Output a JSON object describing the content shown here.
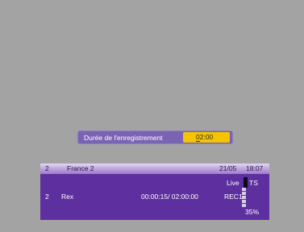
{
  "record_dialog": {
    "label": "Durée de l'enregistrement",
    "value": "02:00"
  },
  "info_bar": {
    "channel_number": "2",
    "channel_name": "France 2",
    "date": "21/05",
    "time": "18:07",
    "live_label": "Live",
    "ts_label": "TS",
    "program_number": "2",
    "program_name": "Rex",
    "progress_text": "00:00:15/ 02:00:00",
    "rec_label": "REC1",
    "level_percent": "35%"
  },
  "colors": {
    "background": "#a3a3a3",
    "panel": "#5e2f9e",
    "dialog": "#7a63b3",
    "value_highlight": "#f5c400"
  }
}
